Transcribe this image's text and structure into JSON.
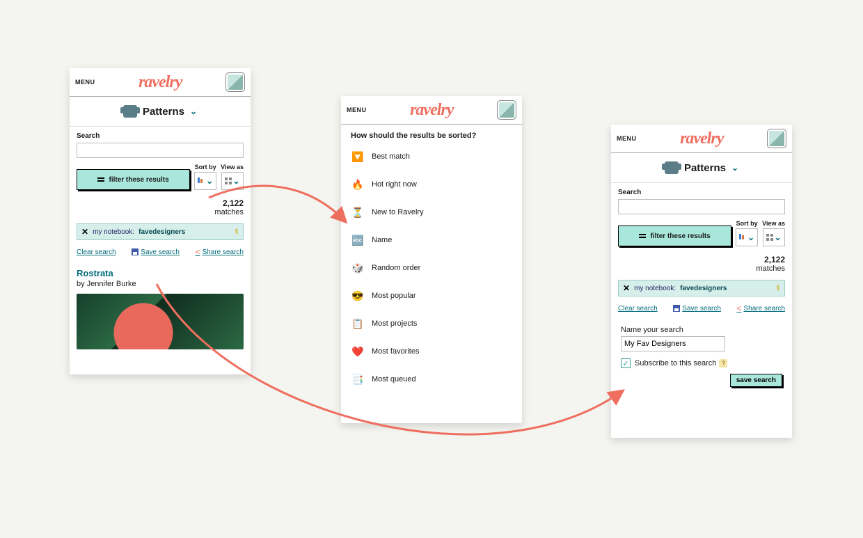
{
  "brand": "ravelry",
  "menu_label": "MENU",
  "heading": {
    "title": "Patterns"
  },
  "search": {
    "label": "Search",
    "value": ""
  },
  "filter_button": "filter these results",
  "sort_label": "Sort by",
  "view_label": "View as",
  "matches": {
    "count": "2,122",
    "label": "matches"
  },
  "tag": {
    "prefix": "my notebook: ",
    "value": "favedesigners"
  },
  "links": {
    "clear": "Clear search",
    "save": "Save search",
    "share": "Share search"
  },
  "result": {
    "title": "Rostrata",
    "by": "by Jennifer Burke"
  },
  "sort_panel": {
    "title": "How should the results be sorted?",
    "items": [
      {
        "icon": "🔽",
        "label": "Best match"
      },
      {
        "icon": "🔥",
        "label": "Hot right now"
      },
      {
        "icon": "⏳",
        "label": "New to Ravelry"
      },
      {
        "icon": "🔤",
        "label": "Name"
      },
      {
        "icon": "🎲",
        "label": "Random order"
      },
      {
        "icon": "😎",
        "label": "Most popular"
      },
      {
        "icon": "📋",
        "label": "Most projects"
      },
      {
        "icon": "❤️",
        "label": "Most favorites"
      },
      {
        "icon": "📑",
        "label": "Most queued"
      }
    ]
  },
  "save_panel": {
    "name_label": "Name your search",
    "name_value": "My Fav Designers",
    "subscribe": "Subscribe to this search",
    "button": "save search"
  }
}
